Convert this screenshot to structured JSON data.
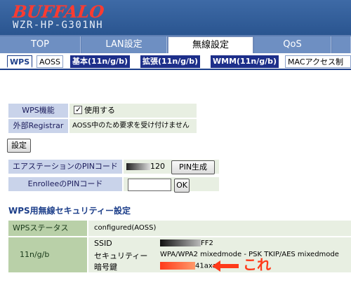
{
  "header": {
    "brand": "BUFFALO",
    "model": "WZR-HP-G301NH"
  },
  "main_tabs": [
    {
      "label": "TOP"
    },
    {
      "label": "LAN設定"
    },
    {
      "label": "無線設定"
    },
    {
      "label": "QoS"
    }
  ],
  "sub_tabs": [
    {
      "label": "WPS"
    },
    {
      "label": "AOSS"
    },
    {
      "label": "基本(11n/g/b)"
    },
    {
      "label": "拡張(11n/g/b)"
    },
    {
      "label": "WMM(11n/g/b)"
    },
    {
      "label": "MACアクセス制"
    }
  ],
  "wps_function": {
    "label": "WPS機能",
    "checkbox_label": "使用する",
    "checked": true
  },
  "external_registrar": {
    "label": "外部Registrar",
    "value": "AOSS中のため要求を受け付けません"
  },
  "settings_button": "設定",
  "ap_pin": {
    "label": "エアステーションのPINコード",
    "value_suffix": "120",
    "button": "PIN生成"
  },
  "enrollee_pin": {
    "label": "EnrolleeのPINコード",
    "placeholder": "",
    "button": "OK"
  },
  "security_section_title": "WPS用無線セキュリティー設定",
  "wps_status": {
    "label": "WPSステータス",
    "value": "configured(AOSS)"
  },
  "band": {
    "label": "11n/g/b",
    "ssid_label": "SSID",
    "ssid_suffix": "FF2",
    "security_label": "セキュリティー",
    "security_value": "WPA/WPA2 mixedmode - PSK TKIP/AES mixedmode",
    "key_label": "暗号鍵",
    "key_suffix": "41axa"
  },
  "annotation": {
    "text": "これ",
    "color": "#ff3a1a"
  },
  "colors": {
    "header_blue": "#2f5a95",
    "brand_red": "#ff3b30",
    "subtab_navy": "#1d2f8a",
    "label_bg": "#c9d3ea",
    "value_bg": "#e8efe2"
  }
}
